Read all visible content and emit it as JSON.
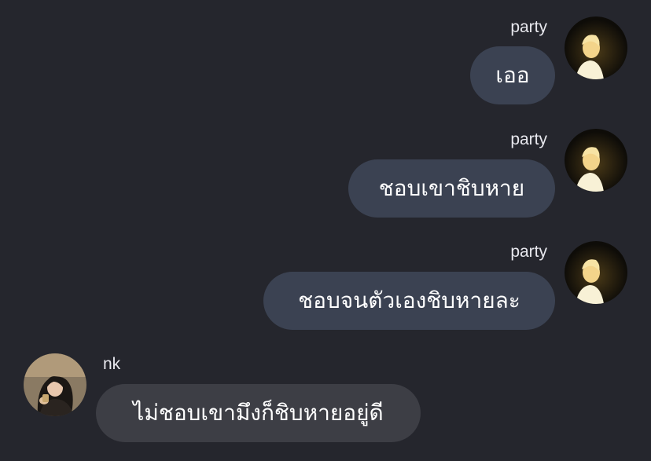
{
  "conversation": {
    "messages": [
      {
        "sender": "party",
        "text": "เออ",
        "side": "right",
        "avatar_icon": "profile-photo-party"
      },
      {
        "sender": "party",
        "text": "ชอบเขาชิบหาย",
        "side": "right",
        "avatar_icon": "profile-photo-party"
      },
      {
        "sender": "party",
        "text": "ชอบจนตัวเองชิบหายละ",
        "side": "right",
        "avatar_icon": "profile-photo-party"
      },
      {
        "sender": "nk",
        "text": "ไม่ชอบเขามึงก็ชิบหายอยู่ดี",
        "side": "left",
        "avatar_icon": "profile-photo-nk"
      }
    ]
  },
  "theme": {
    "background": "#25262d",
    "outgoing_bubble": "#3b4252",
    "incoming_bubble": "#3d3e45",
    "text": "#ffffff"
  }
}
